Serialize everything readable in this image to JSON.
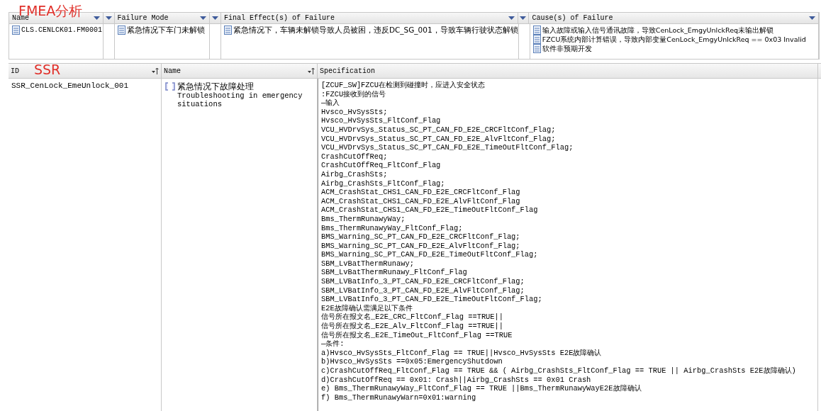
{
  "annotations": [
    {
      "text": "FMEA分析"
    },
    {
      "text": "SSR"
    }
  ],
  "fmea_table": {
    "columns": [
      "Name",
      "Failure Mode",
      "Final Effect(s) of Failure",
      "Cause(s) of Failure"
    ],
    "rows": [
      {
        "name": "CLS.CENLCK01.FM0001",
        "failure_mode": "紧急情况下车门未解锁",
        "final_effect": "紧急情况下，车辆未解锁导致人员被困，违反DC_SG_001，导致车辆行驶状态解锁",
        "causes": [
          "输入故障或输入信号通讯故障，导致CenLock_EmgyUnlckReq未输出解锁",
          "FZCU系统内部计算错误，导致内部变量CenLock_EmgyUnlckReq == 0x03 Invalid",
          "软件非预期开发"
        ]
      }
    ]
  },
  "ssr_table": {
    "columns": [
      "ID",
      "Name",
      "Specification"
    ],
    "rows": [
      {
        "id": "SSR_CenLock_EmeUnlock_001",
        "name_cn": "紧急情况下故障处理",
        "name_en": "Troubleshooting in emergency situations",
        "specification": [
          "[ZCUF_SW]FZCU在检测到碰撞时，应进入安全状态",
          ":FZCU接收到的信号",
          "—输入",
          "Hvsco_HvSysSts;",
          "Hvsco_HvSysSts_FltConf_Flag",
          "VCU_HVDrvSys_Status_SC_PT_CAN_FD_E2E_CRCFltConf_Flag;",
          "VCU_HVDrvSys_Status_SC_PT_CAN_FD_E2E_AlvFltConf_Flag;",
          "VCU_HVDrvSys_Status_SC_PT_CAN_FD_E2E_TimeOutFltConf_Flag;",
          "CrashCutOffReq;",
          "CrashCutOffReq_FltConf_Flag",
          "Airbg_CrashSts;",
          "Airbg_CrashSts_FltConf_Flag;",
          "ACM_CrashStat_CHS1_CAN_FD_E2E_CRCFltConf_Flag",
          "ACM_CrashStat_CHS1_CAN_FD_E2E_AlvFltConf_Flag",
          "ACM_CrashStat_CHS1_CAN_FD_E2E_TimeOutFltConf_Flag",
          "Bms_ThermRunawyWay;",
          "Bms_ThermRunawyWay_FltConf_Flag;",
          "BMS_Warning_SC_PT_CAN_FD_E2E_CRCFltConf_Flag;",
          "BMS_Warning_SC_PT_CAN_FD_E2E_AlvFltConf_Flag;",
          "BMS_Warning_SC_PT_CAN_FD_E2E_TimeOutFltConf_Flag;",
          "SBM_LvBatThermRunawy;",
          "SBM_LvBatThermRunawy_FltConf_Flag",
          "SBM_LVBatInfo_3_PT_CAN_FD_E2E_CRCFltConf_Flag;",
          "SBM_LVBatInfo_3_PT_CAN_FD_E2E_AlvFltConf_Flag;",
          "SBM_LVBatInfo_3_PT_CAN_FD_E2E_TimeOutFltConf_Flag;",
          "E2E故障确认需满足以下条件",
          "信号所在报文名_E2E_CRC_FltConf_Flag ==TRUE||",
          "信号所在报文名_E2E_Alv_FltConf_Flag ==TRUE||",
          "信号所在报文名_E2E_TimeOut_FltConf_Flag ==TRUE",
          "—条件:",
          "a)Hvsco_HvSysSts_FltConf_Flag == TRUE||Hvsco_HvSysSts E2E故障确认",
          "b)Hvsco_HvSysSts ==0x05:EmergencyShutdown",
          "c)CrashCutOffReq_FltConf_Flag == TRUE && ( Airbg_CrashSts_FltConf_Flag == TRUE || Airbg_CrashSts E2E故障确认)",
          "d)CrashCutOffReq == 0x01: Crash||Airbg_CrashSts == 0x01 Crash",
          "e) Bms_ThermRunawyWay_FltConf_Flag == TRUE ||Bms_ThermRunawyWayE2E故障确认",
          "f) Bms_ThermRunawyWarn=0x01:warning"
        ]
      }
    ]
  }
}
